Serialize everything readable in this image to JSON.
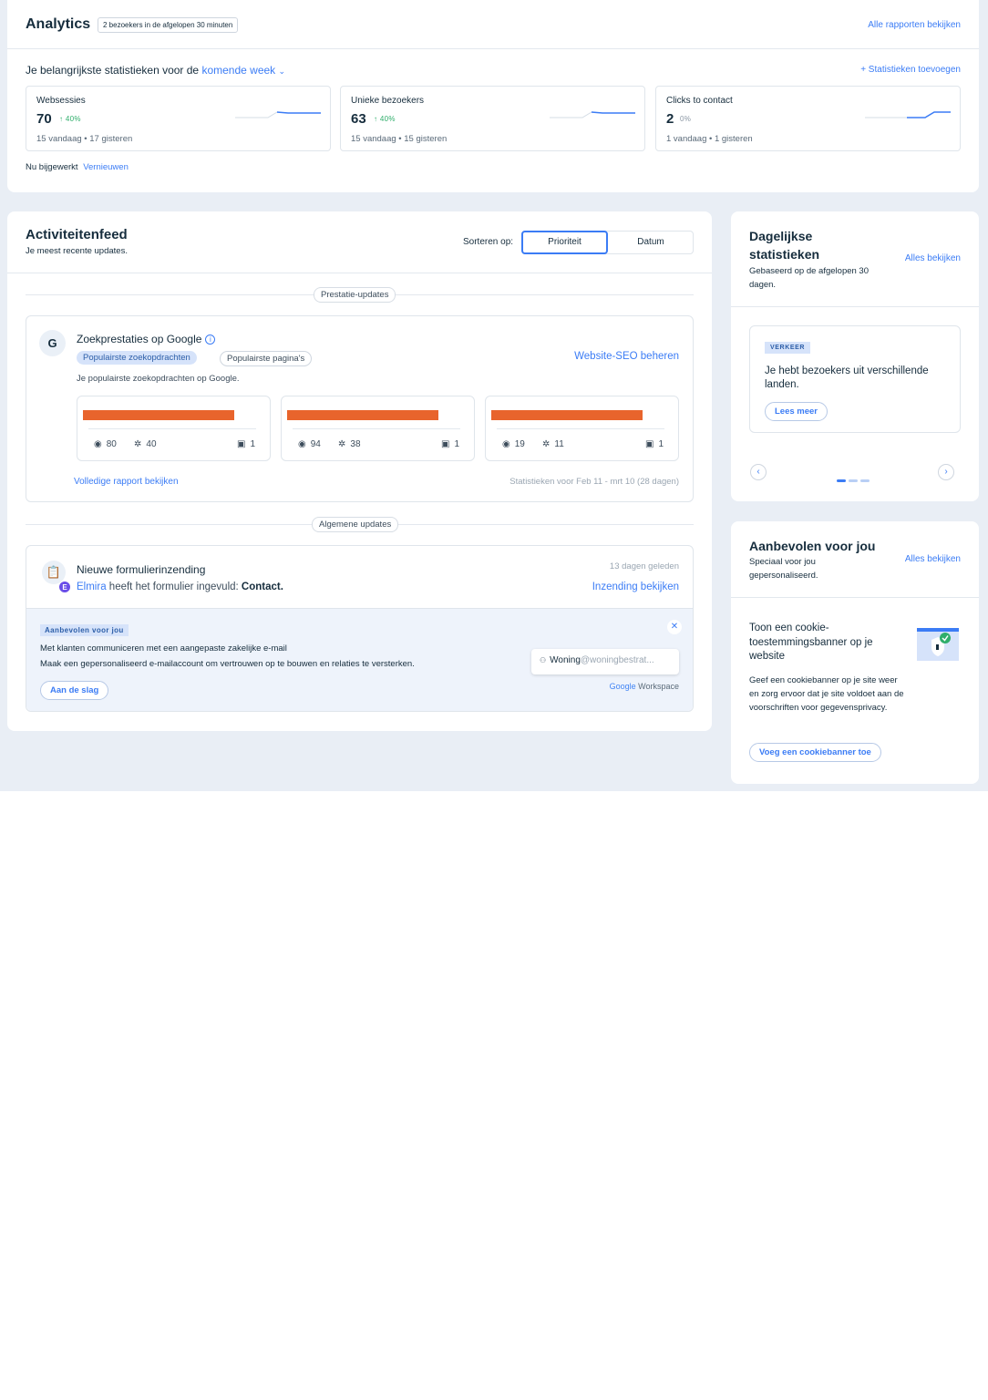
{
  "analytics": {
    "title": "Analytics",
    "badge": "2 bezoekers in de afgelopen 30 minuten",
    "all_reports": "Alle rapporten bekijken",
    "subtitle_prefix": "Je belangrijkste statistieken voor de",
    "period": "komende week",
    "add_stats": "+ Statistieken toevoegen",
    "stats": [
      {
        "label": "Websessies",
        "value": "70",
        "change": "↑ 40%",
        "sub": "15 vandaag • 17 gisteren"
      },
      {
        "label": "Unieke bezoekers",
        "value": "63",
        "change": "↑ 40%",
        "sub": "15 vandaag • 15 gisteren"
      },
      {
        "label": "Clicks to contact",
        "value": "2",
        "change": "0%",
        "sub": "1 vandaag • 1 gisteren"
      }
    ],
    "updated": "Nu bijgewerkt",
    "refresh": "Vernieuwen"
  },
  "feed": {
    "title": "Activiteitenfeed",
    "subtitle": "Je meest recente updates.",
    "sort_label": "Sorteren op:",
    "sort_options": [
      "Prioriteit",
      "Datum"
    ],
    "section_performance": "Prestatie-updates",
    "section_general": "Algemene updates",
    "search": {
      "icon_letter": "G",
      "title": "Zoekprestaties op Google",
      "chip_active": "Populairste zoekopdrachten",
      "chip_inactive": "Populairste pagina's",
      "seo_link": "Website-SEO beheren",
      "description": "Je populairste zoekopdrachten op Google.",
      "queries": [
        {
          "views": "80",
          "clicks": "40",
          "position": "1"
        },
        {
          "views": "94",
          "clicks": "38",
          "position": "1"
        },
        {
          "views": "19",
          "clicks": "11",
          "position": "1"
        }
      ],
      "full_report": "Volledige rapport bekijken",
      "period": "Statistieken voor Feb 11 - mrt 10 (28 dagen)"
    },
    "form": {
      "title": "Nieuwe formulierinzending",
      "avatar_letter": "E",
      "user": "Elmira",
      "text": "heeft het formulier ingevuld:",
      "form_name": "Contact.",
      "time": "13 dagen geleden",
      "link": "Inzending bekijken"
    },
    "reco": {
      "tag": "Aanbevolen voor jou",
      "heading": "Met klanten communiceren met een aangepaste zakelijke e-mail",
      "text": "Maak een gepersonaliseerd e-mailaccount om vertrouwen op te bouwen en relaties te versterken.",
      "button": "Aan de slag",
      "mail_user": "Woning",
      "mail_domain": "@woningbestrat...",
      "provider_brand": "Google",
      "provider_product": "Workspace"
    }
  },
  "daily": {
    "title_line1": "Dagelijkse",
    "title_line2": "statistieken",
    "subtitle": "Gebaseerd op de afgelopen 30 dagen.",
    "all": "Alles bekijken",
    "tag": "VERKEER",
    "tip": "Je hebt bezoekers uit verschillende landen.",
    "button": "Lees meer"
  },
  "recommended": {
    "title": "Aanbevolen voor jou",
    "subtitle": "Speciaal voor jou gepersonaliseerd.",
    "all": "Alles bekijken",
    "item_title": "Toon een cookie-toestemmingsbanner op je website",
    "item_desc": "Geef een cookiebanner op je site weer en zorg ervoor dat je site voldoet aan de voorschriften voor gegevensprivacy.",
    "button": "Voeg een cookiebanner toe"
  },
  "colors": {
    "accent": "#3b7cf5",
    "positive": "#2fae6b",
    "redaction": "#e8642c",
    "background": "#e9eef5"
  }
}
